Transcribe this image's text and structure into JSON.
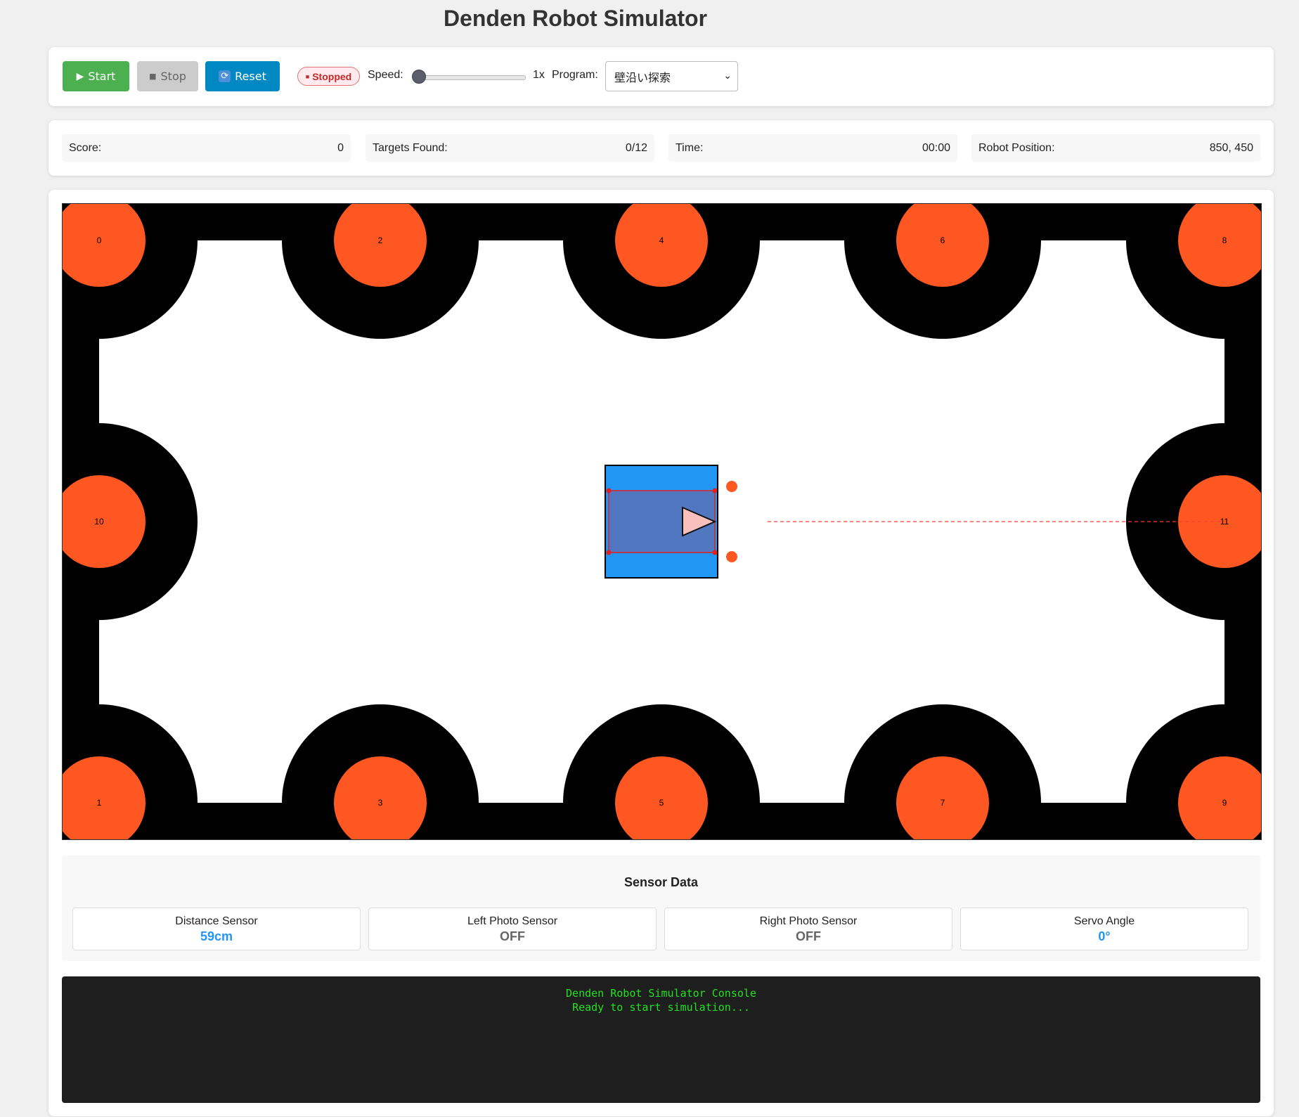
{
  "app": {
    "title": "Denden Robot Simulator"
  },
  "controls": {
    "start_label": "Start",
    "stop_label": "Stop",
    "reset_label": "Reset",
    "status": "Stopped",
    "speed_label": "Speed:",
    "speed_value": "1x",
    "speed_level": 0,
    "program_label": "Program:",
    "program_selected": "壁沿い探索"
  },
  "stats": {
    "score_label": "Score:",
    "score_value": "0",
    "targets_label": "Targets Found:",
    "targets_value": "0/12",
    "time_label": "Time:",
    "time_value": "00:00",
    "position_label": "Robot Position:",
    "position_value": "850, 450"
  },
  "arena": {
    "targets": [
      "0",
      "1",
      "2",
      "3",
      "4",
      "5",
      "6",
      "7",
      "8",
      "9",
      "10",
      "11"
    ]
  },
  "sensors": {
    "title": "Sensor Data",
    "distance_label": "Distance Sensor",
    "distance_value": "59cm",
    "left_photo_label": "Left Photo Sensor",
    "left_photo_value": "OFF",
    "right_photo_label": "Right Photo Sensor",
    "right_photo_value": "OFF",
    "servo_label": "Servo Angle",
    "servo_value": "0°"
  },
  "console": {
    "line1": "Denden Robot Simulator Console",
    "line2": "Ready to start simulation..."
  },
  "colors": {
    "target": "#ff5722",
    "robot_body": "#2196f3",
    "start_button": "#4caf50",
    "reset_button": "#0088c2",
    "console_text": "#22e022",
    "sensor_value_active": "#2196f3",
    "sensor_value_off": "#666666"
  },
  "icons": {
    "start": "play-icon",
    "stop": "square-icon",
    "reset": "refresh-icon",
    "status": "square-icon",
    "program": "chevron-down-icon"
  }
}
